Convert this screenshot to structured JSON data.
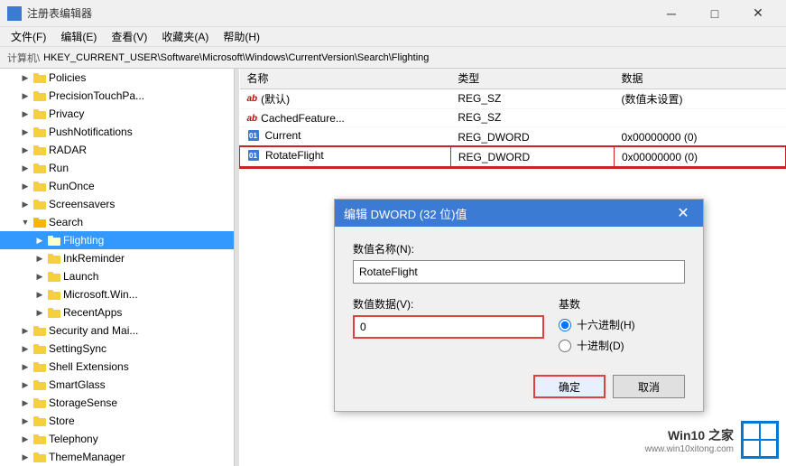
{
  "titleBar": {
    "icon": "📋",
    "title": "注册表编辑器",
    "minBtn": "─",
    "maxBtn": "□",
    "closeBtn": "✕"
  },
  "menuBar": {
    "items": [
      "文件(F)",
      "编辑(E)",
      "查看(V)",
      "收藏夹(A)",
      "帮助(H)"
    ]
  },
  "addressBar": {
    "label": "计算机\\",
    "path": "HKEY_CURRENT_USER\\Software\\Microsoft\\Windows\\CurrentVersion\\Search\\Flighting"
  },
  "tree": {
    "items": [
      {
        "label": "Policies",
        "level": 2,
        "type": "folder",
        "expanded": false,
        "selected": false
      },
      {
        "label": "PrecisionTouchPa...",
        "level": 2,
        "type": "folder",
        "expanded": false,
        "selected": false
      },
      {
        "label": "Privacy",
        "level": 2,
        "type": "folder",
        "expanded": false,
        "selected": false
      },
      {
        "label": "PushNotifications",
        "level": 2,
        "type": "folder",
        "expanded": false,
        "selected": false
      },
      {
        "label": "RADAR",
        "level": 2,
        "type": "folder",
        "expanded": false,
        "selected": false
      },
      {
        "label": "Run",
        "level": 2,
        "type": "folder",
        "expanded": false,
        "selected": false
      },
      {
        "label": "RunOnce",
        "level": 2,
        "type": "folder",
        "expanded": false,
        "selected": false
      },
      {
        "label": "Screensavers",
        "level": 2,
        "type": "folder",
        "expanded": false,
        "selected": false
      },
      {
        "label": "Search",
        "level": 2,
        "type": "folder",
        "expanded": true,
        "selected": false
      },
      {
        "label": "Flighting",
        "level": 3,
        "type": "folder",
        "expanded": false,
        "selected": true
      },
      {
        "label": "InkReminder",
        "level": 3,
        "type": "folder",
        "expanded": false,
        "selected": false
      },
      {
        "label": "Launch",
        "level": 3,
        "type": "folder",
        "expanded": false,
        "selected": false
      },
      {
        "label": "Microsoft.Win...",
        "level": 3,
        "type": "folder",
        "expanded": false,
        "selected": false
      },
      {
        "label": "RecentApps",
        "level": 3,
        "type": "folder",
        "expanded": false,
        "selected": false
      },
      {
        "label": "Security and Mai...",
        "level": 2,
        "type": "folder",
        "expanded": false,
        "selected": false
      },
      {
        "label": "SettingSync",
        "level": 2,
        "type": "folder",
        "expanded": false,
        "selected": false
      },
      {
        "label": "Shell Extensions",
        "level": 2,
        "type": "folder",
        "expanded": false,
        "selected": false
      },
      {
        "label": "SmartGlass",
        "level": 2,
        "type": "folder",
        "expanded": false,
        "selected": false
      },
      {
        "label": "StorageSense",
        "level": 2,
        "type": "folder",
        "expanded": false,
        "selected": false
      },
      {
        "label": "Store",
        "level": 2,
        "type": "folder",
        "expanded": false,
        "selected": false
      },
      {
        "label": "Telephony",
        "level": 2,
        "type": "folder",
        "expanded": false,
        "selected": false
      },
      {
        "label": "ThemeManager",
        "level": 2,
        "type": "folder",
        "expanded": false,
        "selected": false
      }
    ]
  },
  "table": {
    "columns": [
      "名称",
      "类型",
      "数据"
    ],
    "rows": [
      {
        "name": "(默认)",
        "type": "REG_SZ",
        "data": "(数值未设置)",
        "icon": "ab",
        "highlighted": false
      },
      {
        "name": "CachedFeature...",
        "type": "REG_SZ",
        "data": "",
        "icon": "ab",
        "highlighted": false
      },
      {
        "name": "Current",
        "type": "REG_DWORD",
        "data": "0x00000000 (0)",
        "icon": "img",
        "highlighted": false
      },
      {
        "name": "RotateFlight",
        "type": "REG_DWORD",
        "data": "0x00000000 (0)",
        "icon": "img",
        "highlighted": true
      }
    ]
  },
  "dialog": {
    "title": "编辑 DWORD (32 位)值",
    "closeBtn": "✕",
    "nameLabel": "数值名称(N):",
    "nameValue": "RotateFlight",
    "valueLabel": "数值数据(V):",
    "valueInput": "0",
    "baseLabel": "基数",
    "radioOptions": [
      {
        "label": "十六进制(H)",
        "value": "hex",
        "checked": true
      },
      {
        "label": "十进制(D)",
        "value": "dec",
        "checked": false
      }
    ],
    "confirmBtn": "确定",
    "cancelBtn": "取消"
  },
  "watermark": {
    "text": "Win10 之家",
    "url": "www.win10xitong.com"
  }
}
